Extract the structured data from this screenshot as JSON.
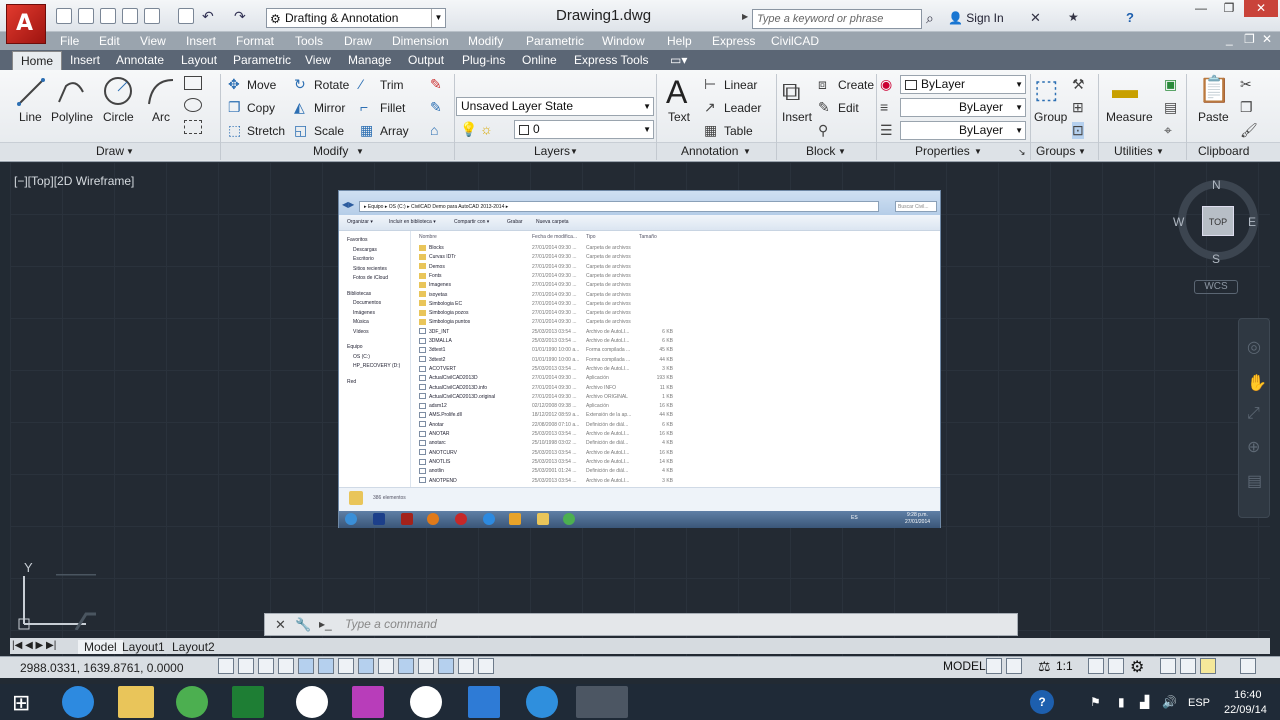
{
  "title_bar": {
    "app_logo": "A",
    "workspace": "Drafting & Annotation",
    "document_title": "Drawing1.dwg",
    "search_placeholder": "Type a keyword or phrase",
    "sign_in": "Sign In"
  },
  "menu_bar": [
    "File",
    "Edit",
    "View",
    "Insert",
    "Format",
    "Tools",
    "Draw",
    "Dimension",
    "Modify",
    "Parametric",
    "Window",
    "Help",
    "Express",
    "CivilCAD"
  ],
  "ribbon_tabs": [
    "Home",
    "Insert",
    "Annotate",
    "Layout",
    "Parametric",
    "View",
    "Manage",
    "Output",
    "Plug-ins",
    "Online",
    "Express Tools"
  ],
  "draw_panel": {
    "title": "Draw",
    "line": "Line",
    "polyline": "Polyline",
    "circle": "Circle",
    "arc": "Arc"
  },
  "modify_panel": {
    "title": "Modify",
    "move": "Move",
    "rotate": "Rotate",
    "trim": "Trim",
    "copy": "Copy",
    "mirror": "Mirror",
    "fillet": "Fillet",
    "stretch": "Stretch",
    "scale": "Scale",
    "array": "Array"
  },
  "layers_panel": {
    "title": "Layers",
    "layer_state": "Unsaved Layer State",
    "current_layer": "0"
  },
  "annotation_panel": {
    "title": "Annotation",
    "text": "Text",
    "linear": "Linear",
    "leader": "Leader",
    "table": "Table"
  },
  "block_panel": {
    "title": "Block",
    "insert": "Insert",
    "create": "Create",
    "edit": "Edit"
  },
  "properties_panel": {
    "title": "Properties",
    "color": "ByLayer",
    "linetype": "ByLayer",
    "lineweight": "ByLayer"
  },
  "groups_panel": {
    "title": "Groups",
    "group": "Group"
  },
  "utilities_panel": {
    "title": "Utilities",
    "measure": "Measure"
  },
  "clipboard_panel": {
    "title": "Clipboard",
    "paste": "Paste"
  },
  "viewport_label": "[−][Top][2D Wireframe]",
  "viewcube": {
    "n": "N",
    "s": "S",
    "e": "E",
    "w": "W",
    "top": "TOP",
    "wcs": "WCS"
  },
  "ucs": {
    "y": "Y"
  },
  "embedded_explorer": {
    "address": "▸ Equipo ▸ OS (C:) ▸ CivilCAD Demo para AutoCAD 2013-2014 ▸",
    "search": "Buscar Civil...",
    "toolbar": [
      "Organizar ▾",
      "Incluir en biblioteca ▾",
      "Compartir con ▾",
      "Grabar",
      "Nueva carpeta"
    ],
    "nav": [
      {
        "label": "Favoritos",
        "indent": 0
      },
      {
        "label": "Descargas",
        "indent": 1
      },
      {
        "label": "Escritorio",
        "indent": 1
      },
      {
        "label": "Sitios recientes",
        "indent": 1
      },
      {
        "label": "Fotos de iCloud",
        "indent": 1
      },
      {
        "label": "Bibliotecas",
        "indent": 0
      },
      {
        "label": "Documentos",
        "indent": 1
      },
      {
        "label": "Imágenes",
        "indent": 1
      },
      {
        "label": "Música",
        "indent": 1
      },
      {
        "label": "Vídeos",
        "indent": 1
      },
      {
        "label": "Equipo",
        "indent": 0
      },
      {
        "label": "OS (C:)",
        "indent": 1
      },
      {
        "label": "HP_RECOVERY (D:)",
        "indent": 1
      },
      {
        "label": "Red",
        "indent": 0
      }
    ],
    "columns": [
      "Nombre",
      "Fecha de modifica...",
      "Tipo",
      "Tamaño"
    ],
    "rows": [
      {
        "name": "Blocks",
        "date": "27/01/2014 09:30 ...",
        "type": "Carpeta de archivos",
        "size": ""
      },
      {
        "name": "Curvas IDTr",
        "date": "27/01/2014 09:30 ...",
        "type": "Carpeta de archivos",
        "size": ""
      },
      {
        "name": "Demos",
        "date": "27/01/2014 09:30 ...",
        "type": "Carpeta de archivos",
        "size": ""
      },
      {
        "name": "Fonts",
        "date": "27/01/2014 09:30 ...",
        "type": "Carpeta de archivos",
        "size": ""
      },
      {
        "name": "Imagenes",
        "date": "27/01/2014 09:30 ...",
        "type": "Carpeta de archivos",
        "size": ""
      },
      {
        "name": "isoyetas",
        "date": "27/01/2014 09:30 ...",
        "type": "Carpeta de archivos",
        "size": ""
      },
      {
        "name": "Simbologia EC",
        "date": "27/01/2014 09:30 ...",
        "type": "Carpeta de archivos",
        "size": ""
      },
      {
        "name": "Simbologia pozos",
        "date": "27/01/2014 09:30 ...",
        "type": "Carpeta de archivos",
        "size": ""
      },
      {
        "name": "Simbologia puntos",
        "date": "27/01/2014 09:30 ...",
        "type": "Carpeta de archivos",
        "size": ""
      },
      {
        "name": "3DF_INT",
        "date": "25/03/2013 03:54 ...",
        "type": "Archivo de AutoLI...",
        "size": "6 KB"
      },
      {
        "name": "3DMALLA",
        "date": "25/03/2013 03:54 ...",
        "type": "Archivo de AutoLI...",
        "size": "6 KB"
      },
      {
        "name": "3dtext1",
        "date": "01/01/1990 10:00 a...",
        "type": "Forma compilada ...",
        "size": "45 KB"
      },
      {
        "name": "3dtext2",
        "date": "01/01/1990 10:00 a...",
        "type": "Forma compilada ...",
        "size": "44 KB"
      },
      {
        "name": "ACOTVERT",
        "date": "25/03/2013 03:54 ...",
        "type": "Archivo de AutoLI...",
        "size": "3 KB"
      },
      {
        "name": "ActualCivilCAD2013D",
        "date": "27/01/2014 09:30 ...",
        "type": "Aplicación",
        "size": "193 KB"
      },
      {
        "name": "ActualCivilCAD2013D.info",
        "date": "27/01/2014 09:30 ...",
        "type": "Archivo INFO",
        "size": "11 KB"
      },
      {
        "name": "ActualCivilCAD2013D.original",
        "date": "27/01/2014 09:30 ...",
        "type": "Archivo ORIGINAL",
        "size": "1 KB"
      },
      {
        "name": "adsm12",
        "date": "02/12/2008 09:38 ...",
        "type": "Aplicación",
        "size": "16 KB"
      },
      {
        "name": "AMS.Prolife.dll",
        "date": "18/12/2012 08:59 a...",
        "type": "Extensión de la ap...",
        "size": "44 KB"
      },
      {
        "name": "Anotar",
        "date": "22/08/2008 07:10 a...",
        "type": "Definición de diál...",
        "size": "6 KB"
      },
      {
        "name": "ANOTAR",
        "date": "25/03/2013 03:54 ...",
        "type": "Archivo de AutoLI...",
        "size": "16 KB"
      },
      {
        "name": "anotarc",
        "date": "25/10/1998 03:02 ...",
        "type": "Definición de diál...",
        "size": "4 KB"
      },
      {
        "name": "ANOTCURV",
        "date": "25/03/2013 03:54 ...",
        "type": "Archivo de AutoLI...",
        "size": "16 KB"
      },
      {
        "name": "ANOTLIS",
        "date": "25/03/2013 03:54 ...",
        "type": "Archivo de AutoLI...",
        "size": "14 KB"
      },
      {
        "name": "anotlin",
        "date": "25/03/2001 01:24 ...",
        "type": "Definición de diál...",
        "size": "4 KB"
      },
      {
        "name": "ANOTPEND",
        "date": "25/03/2013 03:54 ...",
        "type": "Archivo de AutoLI...",
        "size": "3 KB"
      }
    ],
    "status": "386 elementos",
    "tray_time": "9:28 p.m.",
    "tray_date": "27/01/2014",
    "tray_lang": "ES"
  },
  "command_line": {
    "placeholder": "Type a command"
  },
  "layout_tabs": [
    "Model",
    "Layout1",
    "Layout2"
  ],
  "status_bar": {
    "coords": "2988.0331, 1639.8761, 0.0000",
    "model": "MODEL",
    "scale": "1:1"
  },
  "taskbar": {
    "time": "16:40",
    "date": "22/09/14",
    "lang": "ESP"
  },
  "colors": {
    "canvas": "#232a33",
    "ribbon_tab_bar": "#5b6675",
    "autocad_red": "#c5241a",
    "taskbar": "#1f2a37"
  }
}
